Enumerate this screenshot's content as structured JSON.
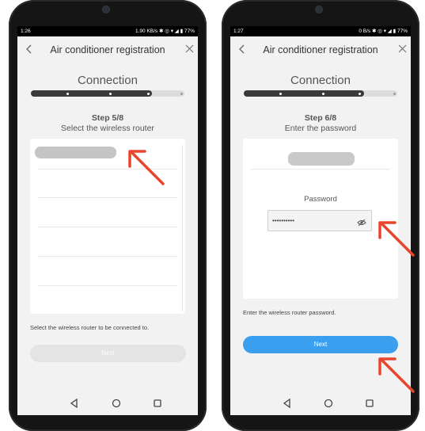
{
  "left_screen": {
    "status": {
      "time": "1:26",
      "right": "1.90 KB/s ✱ ◎ ▾ ◢ ▮ 77%"
    },
    "title": "Air conditioner registration",
    "section": "Connection",
    "progress": {
      "current_step": 5,
      "total_steps": 8
    },
    "step_number": "Step 5/8",
    "step_desc": "Select the wireless router",
    "hint": "Select the wireless router to be connected to.",
    "button_label": "Next"
  },
  "right_screen": {
    "status": {
      "time": "1:27",
      "right": "0 B/s ✱ ◎ ▾ ◢ ▮ 77%"
    },
    "title": "Air conditioner registration",
    "section": "Connection",
    "progress": {
      "current_step": 6,
      "total_steps": 8
    },
    "step_number": "Step 6/8",
    "step_desc": "Enter the password",
    "password_label": "Password",
    "password_value": "••••••••••",
    "hint": "Enter the wireless router password.",
    "button_label": "Next"
  },
  "icons": {
    "back": "chevron-left-icon",
    "close": "close-icon",
    "eye": "eye-slash-icon",
    "nav_back": "triangle-back-icon",
    "nav_home": "circle-home-icon",
    "nav_recent": "square-recent-icon"
  },
  "colors": {
    "primary_button": "#3b9ff0",
    "disabled_button": "#e4e4e4",
    "annotation_arrow": "#e8452c",
    "progress_fill": "#3a3a3a"
  }
}
